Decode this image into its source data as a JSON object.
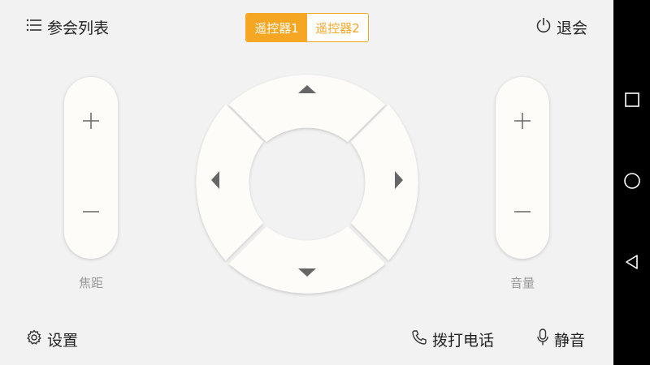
{
  "header": {
    "participants_label": "参会列表",
    "exit_label": "退会"
  },
  "tabs": [
    {
      "label": "遥控器1",
      "active": true
    },
    {
      "label": "遥控器2",
      "active": false
    }
  ],
  "focus": {
    "label": "焦距",
    "plus": "+",
    "minus": "—"
  },
  "volume": {
    "label": "音量",
    "plus": "+",
    "minus": "—"
  },
  "footer": {
    "settings_label": "设置",
    "dial_label": "拨打电话",
    "mute_label": "静音"
  },
  "colors": {
    "accent": "#f5a623",
    "pad": "#fdfcf8",
    "background": "#f2f2f2"
  }
}
